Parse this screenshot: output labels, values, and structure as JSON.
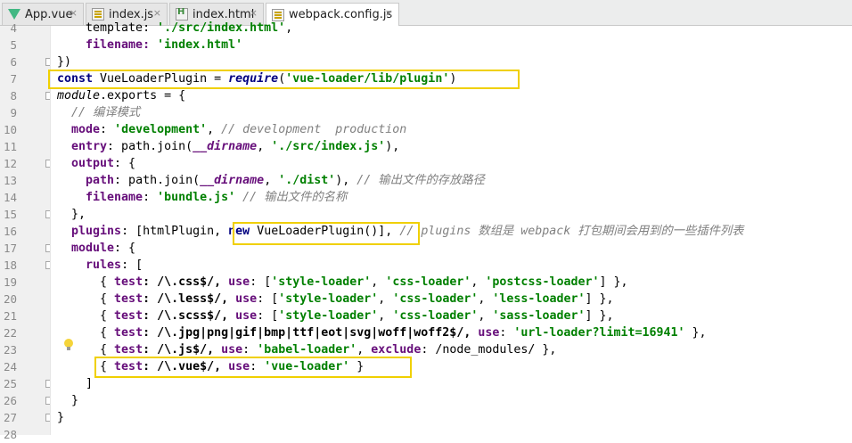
{
  "tabs": [
    {
      "label": "App.vue",
      "icon": "vue-file-icon",
      "active": false
    },
    {
      "label": "index.js",
      "icon": "js-file-icon",
      "active": false
    },
    {
      "label": "index.html",
      "icon": "html-file-icon",
      "active": false
    },
    {
      "label": "webpack.config.js",
      "icon": "js-file-icon",
      "active": true
    }
  ],
  "close_glyph": "×",
  "gutter": {
    "line_numbers": [
      "4",
      "5",
      "6",
      "7",
      "8",
      "9",
      "10",
      "11",
      "12",
      "13",
      "14",
      "15",
      "16",
      "17",
      "18",
      "19",
      "20",
      "21",
      "22",
      "23",
      "24",
      "25",
      "26",
      "27",
      "28"
    ]
  },
  "code": {
    "l4": {
      "a": "    template: ",
      "b": "'./src/index.html'",
      "c": ","
    },
    "l5": {
      "a": "    filename: ",
      "b": "'index.html'"
    },
    "l6": {
      "a": "})"
    },
    "l7": {
      "kw": "const",
      "a": " VueLoaderPlugin = ",
      "fn": "require",
      "b": "(",
      "str": "'vue-loader/lib/plugin'",
      "c": ")"
    },
    "l8": {
      "a": "module",
      "b": ".exports = {"
    },
    "l9": {
      "com": "  // 编译模式"
    },
    "l10": {
      "prop": "  mode",
      "a": ": ",
      "str": "'development'",
      "b": ", ",
      "com": "// development  production"
    },
    "l11": {
      "prop": "  entry",
      "a": ": path.join(",
      "glob": "__dirname",
      "b": ", ",
      "str": "'./src/index.js'",
      "c": "),"
    },
    "l12": {
      "prop": "  output",
      "a": ": {"
    },
    "l13": {
      "prop": "    path",
      "a": ": path.join(",
      "glob": "__dirname",
      "b": ", ",
      "str": "'./dist'",
      "c": "), ",
      "com": "// 输出文件的存放路径"
    },
    "l14": {
      "prop": "    filename",
      "a": ": ",
      "str": "'bundle.js'",
      "b": " ",
      "com": "// 输出文件的名称"
    },
    "l15": {
      "a": "  },"
    },
    "l16": {
      "prop": "  plugins",
      "a": ": [htmlPlugin, ",
      "kw": "new",
      "b": " VueLoaderPlugin()], ",
      "com": "// plugins 数组是 webpack 打包期间会用到的一些插件列表"
    },
    "l17": {
      "prop": "  module",
      "a": ": {"
    },
    "l18": {
      "prop": "    rules",
      "a": ": ["
    },
    "l19": {
      "a": "      { ",
      "p1": "test",
      "b": ": /\\.css$/, ",
      "p2": "use",
      "c": ": [",
      "s1": "'style-loader'",
      "d": ", ",
      "s2": "'css-loader'",
      "e": ", ",
      "s3": "'postcss-loader'",
      "f": "] },"
    },
    "l20": {
      "a": "      { ",
      "p1": "test",
      "b": ": /\\.less$/, ",
      "p2": "use",
      "c": ": [",
      "s1": "'style-loader'",
      "d": ", ",
      "s2": "'css-loader'",
      "e": ", ",
      "s3": "'less-loader'",
      "f": "] },"
    },
    "l21": {
      "a": "      { ",
      "p1": "test",
      "b": ": /\\.scss$/, ",
      "p2": "use",
      "c": ": [",
      "s1": "'style-loader'",
      "d": ", ",
      "s2": "'css-loader'",
      "e": ", ",
      "s3": "'sass-loader'",
      "f": "] },"
    },
    "l22": {
      "a": "      { ",
      "p1": "test",
      "b": ": /\\.jpg|png|gif|bmp|ttf|eot|svg|woff|woff2$/, ",
      "p2": "use",
      "c": ": ",
      "s1": "'url-loader?limit=16941'",
      "d": " },"
    },
    "l23": {
      "a": "      { ",
      "p1": "test",
      "b": ": /\\.js$/, ",
      "p2": "use",
      "c": ": ",
      "s1": "'babel-loader'",
      "d": ", ",
      "p3": "exclude",
      "e": ": /node_modules/ },"
    },
    "l24": {
      "a": "      { ",
      "p1": "test",
      "b": ": /\\.vue$/, ",
      "p2": "use",
      "c": ": ",
      "s1": "'vue-loader'",
      "d": " }"
    },
    "l25": {
      "a": "    ]"
    },
    "l26": {
      "a": "  }"
    },
    "l27": {
      "a": "}"
    }
  },
  "colors": {
    "highlight_box": "#f0d000",
    "keyword": "#000080",
    "string": "#008000",
    "comment": "#808080",
    "property": "#660e7a"
  }
}
